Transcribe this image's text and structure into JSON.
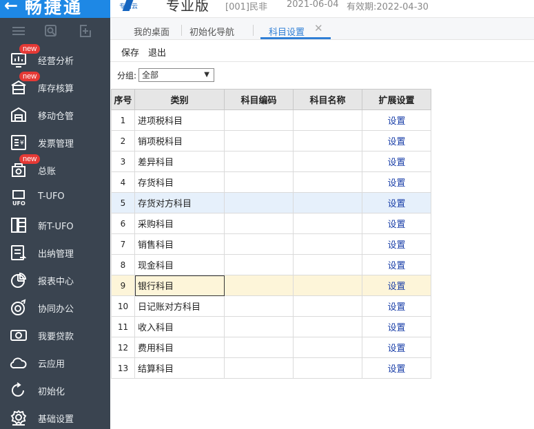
{
  "brand": {
    "name": "畅捷通",
    "icon": "back-arrow-icon"
  },
  "product": {
    "sub": "专属云",
    "edition": "专业版",
    "account": "[001]民非",
    "date": "2021-06-04",
    "expiry": "有效期:2022-04-30"
  },
  "sidebar": {
    "tools": [
      "menu-icon",
      "search-settings-icon",
      "add-window-icon"
    ],
    "items": [
      {
        "label": "经营分析",
        "badge": "new",
        "icon": "chart-icon"
      },
      {
        "label": "库存核算",
        "badge": "new",
        "icon": "inventory-icon"
      },
      {
        "label": "移动仓管",
        "badge": "",
        "icon": "warehouse-icon"
      },
      {
        "label": "发票管理",
        "badge": "",
        "icon": "invoice-icon"
      },
      {
        "label": "总账",
        "badge": "new",
        "icon": "ledger-icon"
      },
      {
        "label": "T-UFO",
        "badge": "",
        "icon": "ufo-icon"
      },
      {
        "label": "新T-UFO",
        "badge": "",
        "icon": "new-ufo-icon"
      },
      {
        "label": "出纳管理",
        "badge": "",
        "icon": "cashier-icon"
      },
      {
        "label": "报表中心",
        "badge": "",
        "icon": "pie-chart-icon"
      },
      {
        "label": "协同办公",
        "badge": "",
        "icon": "collaboration-icon"
      },
      {
        "label": "我要贷款",
        "badge": "",
        "icon": "loan-icon"
      },
      {
        "label": "云应用",
        "badge": "",
        "icon": "cloud-icon"
      },
      {
        "label": "初始化",
        "badge": "",
        "icon": "refresh-icon"
      },
      {
        "label": "基础设置",
        "badge": "",
        "icon": "gear-icon"
      }
    ]
  },
  "tabs": [
    {
      "label": "我的桌面"
    },
    {
      "label": "初始化导航"
    },
    {
      "label": "科目设置",
      "active": true
    }
  ],
  "toolbar": {
    "save": "保存",
    "exit": "退出"
  },
  "filter": {
    "label": "分组:",
    "value": "全部"
  },
  "table": {
    "headers": [
      "序号",
      "类别",
      "科目编码",
      "科目名称",
      "扩展设置"
    ],
    "rows": [
      {
        "no": "1",
        "category": "进项税科目",
        "code": "",
        "name": "",
        "action": "设置"
      },
      {
        "no": "2",
        "category": "销项税科目",
        "code": "",
        "name": "",
        "action": "设置"
      },
      {
        "no": "3",
        "category": "差异科目",
        "code": "",
        "name": "",
        "action": "设置"
      },
      {
        "no": "4",
        "category": "存货科目",
        "code": "",
        "name": "",
        "action": "设置"
      },
      {
        "no": "5",
        "category": "存货对方科目",
        "code": "",
        "name": "",
        "action": "设置"
      },
      {
        "no": "6",
        "category": "采购科目",
        "code": "",
        "name": "",
        "action": "设置"
      },
      {
        "no": "7",
        "category": "销售科目",
        "code": "",
        "name": "",
        "action": "设置"
      },
      {
        "no": "8",
        "category": "现金科目",
        "code": "",
        "name": "",
        "action": "设置"
      },
      {
        "no": "9",
        "category": "银行科目",
        "code": "",
        "name": "",
        "action": "设置"
      },
      {
        "no": "10",
        "category": "日记账对方科目",
        "code": "",
        "name": "",
        "action": "设置"
      },
      {
        "no": "11",
        "category": "收入科目",
        "code": "",
        "name": "",
        "action": "设置"
      },
      {
        "no": "12",
        "category": "费用科目",
        "code": "",
        "name": "",
        "action": "设置"
      },
      {
        "no": "13",
        "category": "结算科目",
        "code": "",
        "name": "",
        "action": "设置"
      }
    ]
  },
  "colors": {
    "brand": "#1e88e5",
    "sidebar": "#3a4450",
    "accent": "#2f7fd6",
    "link": "#1a3fa8",
    "badge": "#e53935"
  }
}
